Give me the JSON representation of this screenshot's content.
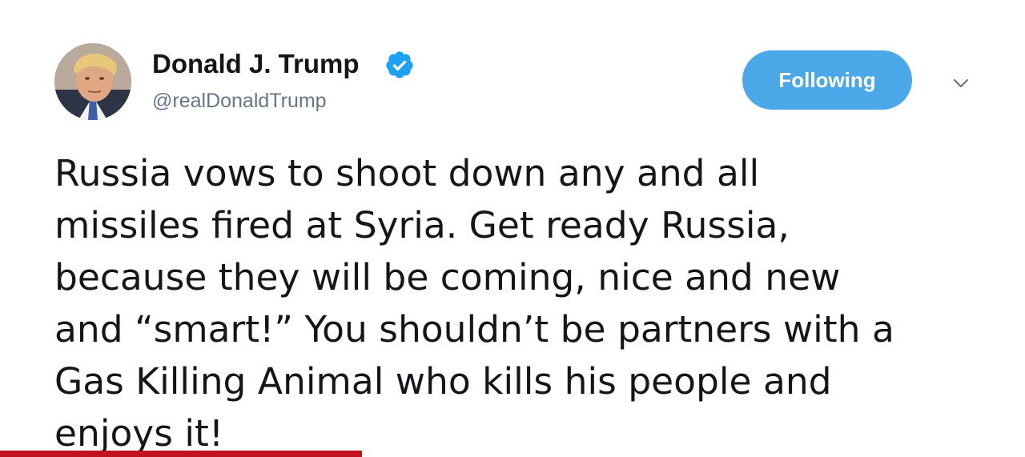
{
  "tweet": {
    "author": {
      "name": "Donald J. Trump",
      "handle": "@realDonaldTrump",
      "verified": true,
      "avatar_icon": "profile-avatar"
    },
    "follow_button_label": "Following",
    "menu_icon": "chevron-down-icon",
    "text_lines": [
      "Russia vows to shoot down any and all",
      "missiles fired at Syria. Get ready Russia,",
      "because they will be coming, nice and new",
      "and “smart!” You shouldn’t be partners with a",
      "Gas Killing Animal who kills his people and",
      "enjoys it!"
    ]
  },
  "colors": {
    "accent": "#4aa8e8",
    "verified_badge": "#1da1f2",
    "handle_gray": "#657786",
    "text": "#14171a",
    "bottom_bar": "#c1121f"
  }
}
